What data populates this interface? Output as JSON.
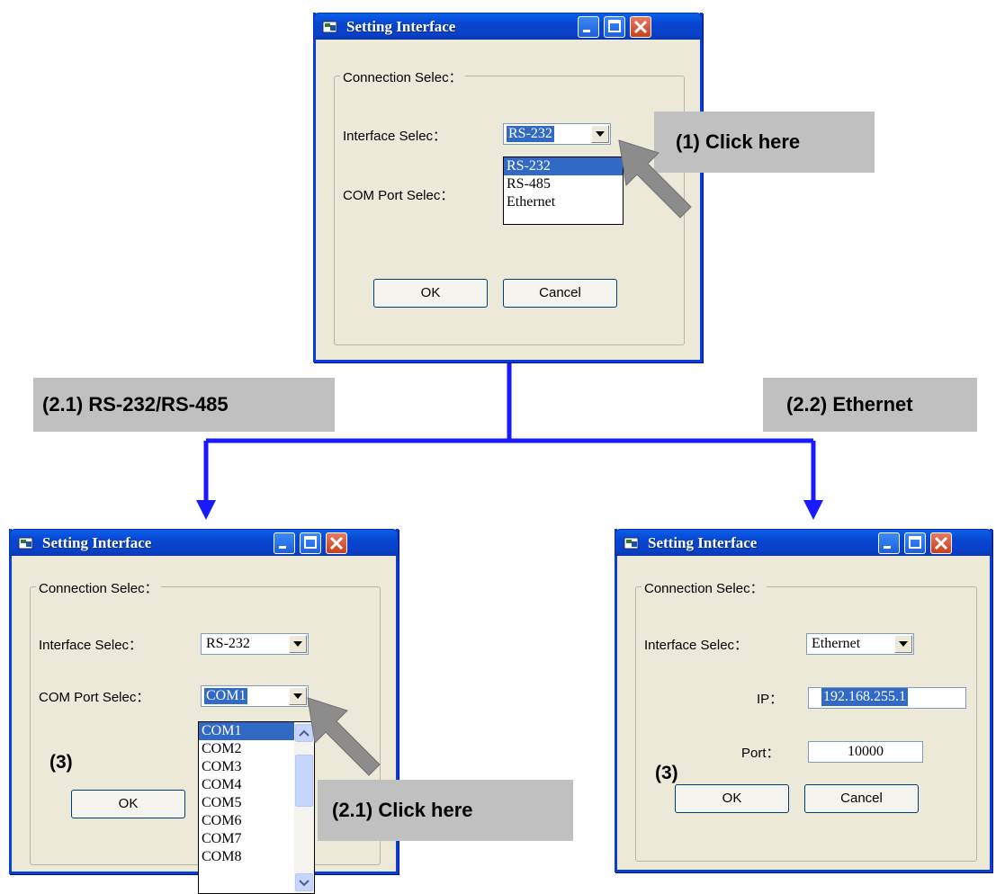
{
  "callouts": {
    "step1": "(1) Click here",
    "step21_header": "(2.1) RS-232/RS-485",
    "step22_header": "(2.2) Ethernet",
    "step21_click": "(2.1) Click here",
    "step3": "(3)"
  },
  "dialog_top": {
    "title": "Setting Interface",
    "group_label": "Connection Selec：",
    "interface_label": "Interface Selec：",
    "interface_value": "RS-232",
    "com_label": "COM Port Selec：",
    "dropdown_options": [
      "RS-232",
      "RS-485",
      "Ethernet"
    ],
    "dropdown_selected": "RS-232",
    "ok": "OK",
    "cancel": "Cancel"
  },
  "dialog_serial": {
    "title": "Setting Interface",
    "group_label": "Connection Selec：",
    "interface_label": "Interface Selec：",
    "interface_value": "RS-232",
    "com_label": "COM Port Selec：",
    "com_value": "COM1",
    "com_options": [
      "COM1",
      "COM2",
      "COM3",
      "COM4",
      "COM5",
      "COM6",
      "COM7",
      "COM8"
    ],
    "com_selected": "COM1",
    "ok": "OK"
  },
  "dialog_ethernet": {
    "title": "Setting Interface",
    "group_label": "Connection Selec：",
    "interface_label": "Interface Selec：",
    "interface_value": "Ethernet",
    "ip_label": "IP：",
    "ip_value": "192.168.255.1",
    "port_label": "Port：",
    "port_value": "10000",
    "ok": "OK",
    "cancel": "Cancel"
  },
  "colors": {
    "connector": "#1a1aff",
    "arrow_gray": "#8c8c8c",
    "callout_bg": "#c0c0c0",
    "selection": "#316ac5"
  },
  "icons": [
    "app-icon",
    "minimize-icon",
    "maximize-icon",
    "close-icon",
    "dropdown-arrow-icon",
    "pointer-arrow-icon",
    "scroll-up-icon",
    "scroll-down-icon"
  ]
}
